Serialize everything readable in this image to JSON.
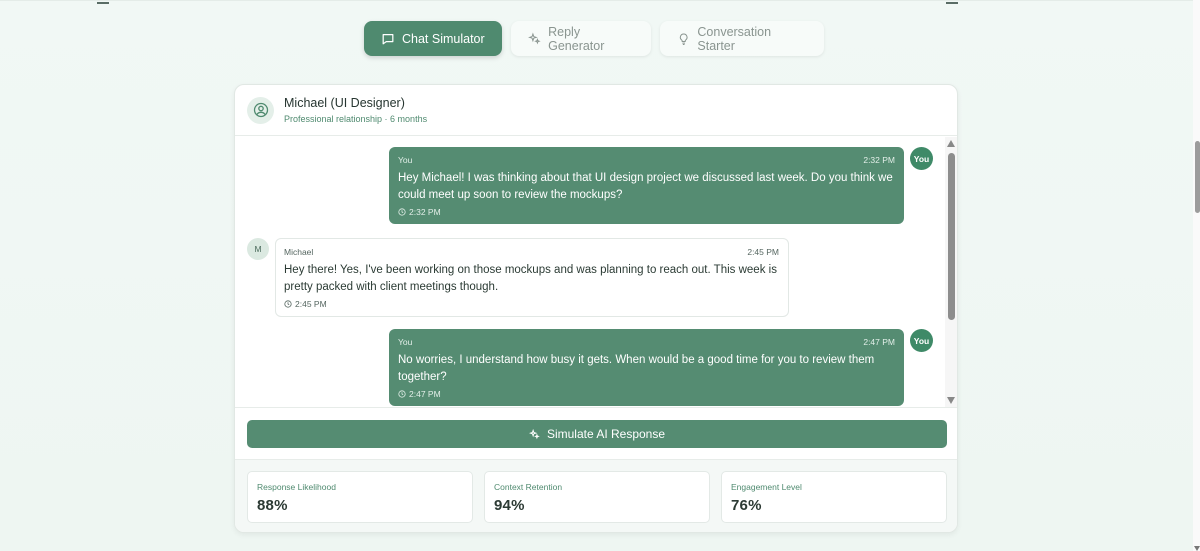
{
  "tabs": [
    {
      "label": "Chat Simulator",
      "icon": "chat-bubble-icon",
      "active": true
    },
    {
      "label": "Reply Generator",
      "icon": "sparkles-icon",
      "active": false
    },
    {
      "label": "Conversation Starter",
      "icon": "lightbulb-icon",
      "active": false
    }
  ],
  "header": {
    "name": "Michael (UI Designer)",
    "subtitle": "Professional relationship · 6 months"
  },
  "messages": [
    {
      "sender": "You",
      "badge": "You",
      "time": "2:32 PM",
      "text": "Hey Michael! I was thinking about that UI design project we discussed last week. Do you think we could meet up soon to review the mockups?",
      "footer_time": "2:32 PM"
    },
    {
      "sender": "Michael",
      "badge": "M",
      "time": "2:45 PM",
      "text": "Hey there! Yes, I've been working on those mockups and was planning to reach out. This week is pretty packed with client meetings though.",
      "footer_time": "2:45 PM"
    },
    {
      "sender": "You",
      "badge": "You",
      "time": "2:47 PM",
      "text": "No worries, I understand how busy it gets. When would be a good time for you to review them together?",
      "footer_time": "2:47 PM"
    }
  ],
  "action": {
    "simulate_label": "Simulate AI Response"
  },
  "metrics": [
    {
      "label": "Response Likelihood",
      "value": "88%"
    },
    {
      "label": "Context Retention",
      "value": "94%"
    },
    {
      "label": "Engagement Level",
      "value": "76%"
    }
  ],
  "colors": {
    "accent": "#558c72",
    "badge": "#3f8a68",
    "background": "#f1f8f5"
  }
}
